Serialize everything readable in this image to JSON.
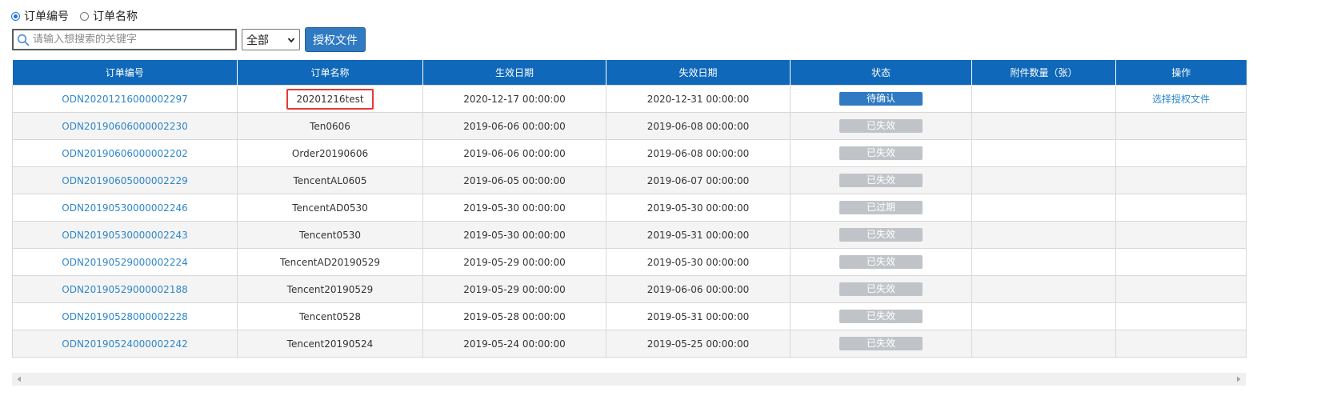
{
  "filters": {
    "radio_options": [
      {
        "label": "订单编号",
        "checked": true
      },
      {
        "label": "订单名称",
        "checked": false
      }
    ],
    "search": {
      "placeholder": "请输入想搜索的关键字",
      "value": ""
    },
    "select": {
      "value": "全部"
    },
    "auth_button": "授权文件"
  },
  "table": {
    "columns": [
      "订单编号",
      "订单名称",
      "生效日期",
      "失效日期",
      "状态",
      "附件数量（张）",
      "操作"
    ],
    "rows": [
      {
        "id": "ODN20201216000002297",
        "name": "20201216test",
        "start": "2020-12-17 00:00:00",
        "end": "2020-12-31 00:00:00",
        "status": "待确认",
        "attachments": "",
        "action": "选择授权文件"
      },
      {
        "id": "ODN20190606000002230",
        "name": "Ten0606",
        "start": "2019-06-06 00:00:00",
        "end": "2019-06-08 00:00:00",
        "status": "已失效",
        "attachments": "",
        "action": ""
      },
      {
        "id": "ODN20190606000002202",
        "name": "Order20190606",
        "start": "2019-06-06 00:00:00",
        "end": "2019-06-08 00:00:00",
        "status": "已失效",
        "attachments": "",
        "action": ""
      },
      {
        "id": "ODN20190605000002229",
        "name": "TencentAL0605",
        "start": "2019-06-05 00:00:00",
        "end": "2019-06-07 00:00:00",
        "status": "已失效",
        "attachments": "",
        "action": ""
      },
      {
        "id": "ODN20190530000002246",
        "name": "TencentAD0530",
        "start": "2019-05-30 00:00:00",
        "end": "2019-05-30 00:00:00",
        "status": "已过期",
        "attachments": "",
        "action": ""
      },
      {
        "id": "ODN20190530000002243",
        "name": "Tencent0530",
        "start": "2019-05-30 00:00:00",
        "end": "2019-05-31 00:00:00",
        "status": "已失效",
        "attachments": "",
        "action": ""
      },
      {
        "id": "ODN20190529000002224",
        "name": "TencentAD20190529",
        "start": "2019-05-29 00:00:00",
        "end": "2019-05-30 00:00:00",
        "status": "已失效",
        "attachments": "",
        "action": ""
      },
      {
        "id": "ODN20190529000002188",
        "name": "Tencent20190529",
        "start": "2019-05-29 00:00:00",
        "end": "2019-06-06 00:00:00",
        "status": "已失效",
        "attachments": "",
        "action": ""
      },
      {
        "id": "ODN20190528000002228",
        "name": "Tencent0528",
        "start": "2019-05-28 00:00:00",
        "end": "2019-05-31 00:00:00",
        "status": "已失效",
        "attachments": "",
        "action": ""
      },
      {
        "id": "ODN20190524000002242",
        "name": "Tencent20190524",
        "start": "2019-05-24 00:00:00",
        "end": "2019-05-25 00:00:00",
        "status": "已失效",
        "attachments": "",
        "action": ""
      }
    ]
  },
  "colors": {
    "header_bg": "#0f68b9",
    "link": "#2f86c9",
    "status_active": "#2f7ac2",
    "status_inactive": "#c0c4c9",
    "highlight_border": "#e53935"
  }
}
